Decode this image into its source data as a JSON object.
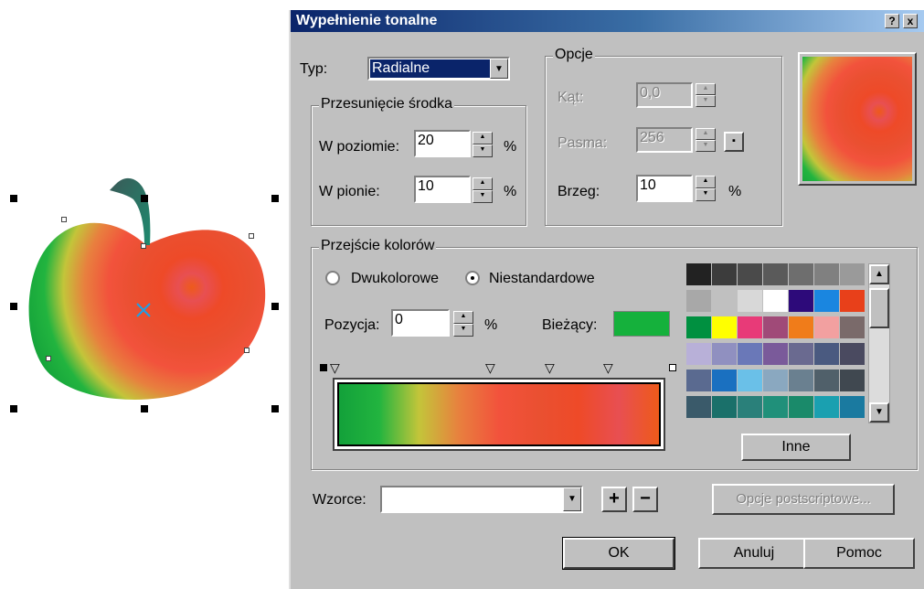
{
  "dialog": {
    "title": "Wypełnienie tonalne",
    "help_btn": "?",
    "close_btn": "x"
  },
  "type": {
    "label": "Typ:",
    "value": "Radialne"
  },
  "center_offset": {
    "title": "Przesunięcie środka",
    "horizontal_label": "W poziomie:",
    "horizontal_value": "20",
    "horizontal_unit": "%",
    "vertical_label": "W pionie:",
    "vertical_value": "10",
    "vertical_unit": "%"
  },
  "options": {
    "title": "Opcje",
    "angle_label": "Kąt:",
    "angle_value": "0,0",
    "steps_label": "Pasma:",
    "steps_value": "256",
    "edge_label": "Brzeg:",
    "edge_value": "10",
    "edge_unit": "%"
  },
  "blend": {
    "title": "Przejście kolorów",
    "two_color_label": "Dwukolorowe",
    "custom_label": "Niestandardowe",
    "custom_selected": true,
    "position_label": "Pozycja:",
    "position_value": "0",
    "position_unit": "%",
    "current_label": "Bieżący:",
    "current_color": "#15b13c",
    "other_button": "Inne",
    "gradient_stops": [
      "#13a13a",
      "#22b43f",
      "#c3c53a",
      "#e8803e",
      "#f2523c",
      "#ea5031",
      "#ee4a28",
      "#e84f52",
      "#ee5a1a"
    ],
    "palette": [
      [
        "#222222",
        "#3c3c3c",
        "#4a4a4a",
        "#5a5a5a",
        "#6e6e6e",
        "#808080",
        "#9a9a9a"
      ],
      [
        "#a8a8a8",
        "#c0c0c0",
        "#d8d8d8",
        "#ffffff",
        "#2d0a7a",
        "#1a86e0",
        "#e8401a"
      ],
      [
        "#009040",
        "#ffff00",
        "#e83a78",
        "#a04a78",
        "#f07c1a",
        "#f2a0a0",
        "#7a6a6a"
      ],
      [
        "#b8b0d8",
        "#9090c0",
        "#6a78b8",
        "#7a5a9a",
        "#6a6a90",
        "#4a5a80",
        "#4a4a60"
      ],
      [
        "#5a6a90",
        "#1a70c0",
        "#6ac0e8",
        "#8aa8c0",
        "#6a8090",
        "#50606a",
        "#404850"
      ],
      [
        "#3a5a6a",
        "#1a706a",
        "#2a807a",
        "#20907a",
        "#1a8a6a",
        "#1aa0b0",
        "#1a7aa0"
      ]
    ]
  },
  "presets": {
    "label": "Wzorce:",
    "value": "",
    "add": "+",
    "remove": "−"
  },
  "postscript_button": "Opcje postscriptowe...",
  "ok_button": "OK",
  "cancel_button": "Anuluj",
  "help_button": "Pomoc"
}
